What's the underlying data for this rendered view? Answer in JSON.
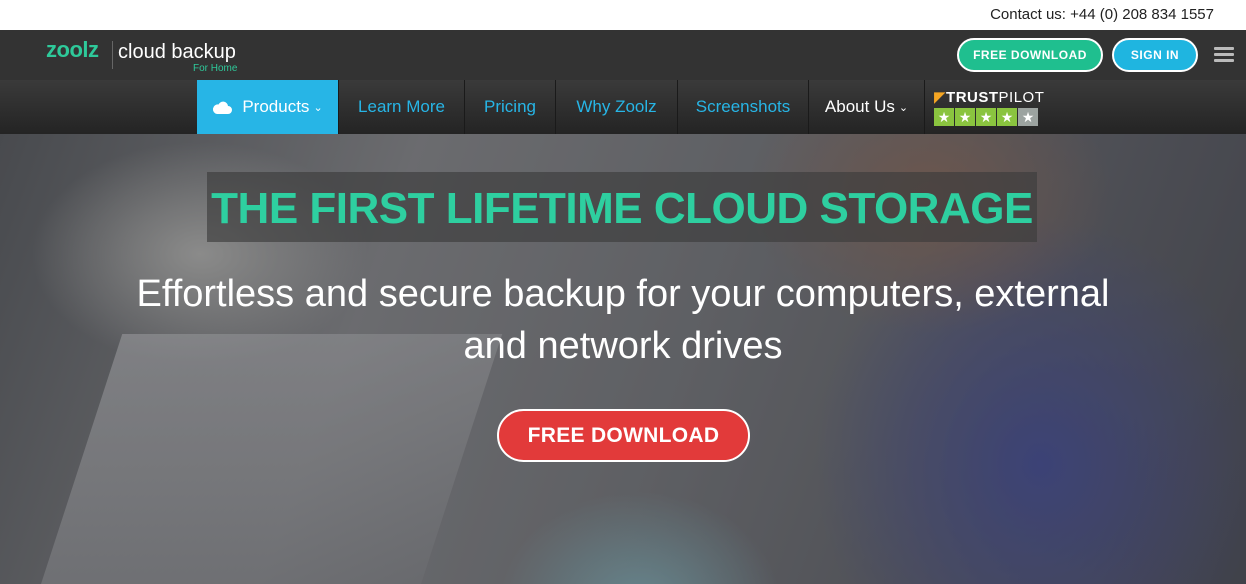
{
  "contact": {
    "text": "Contact us: +44 (0) 208 834 1557"
  },
  "header": {
    "logo_brand": "zoolz",
    "logo_product": "cloud backup",
    "logo_sub": "For Home",
    "free_download_label": "FREE DOWNLOAD",
    "sign_in_label": "SIGN IN",
    "menu_icon": "hamburger-menu-icon"
  },
  "nav": {
    "items": [
      {
        "label": "Products",
        "active": true,
        "icon": "cloud-icon",
        "has_dropdown": true
      },
      {
        "label": "Learn More"
      },
      {
        "label": "Pricing"
      },
      {
        "label": "Why Zoolz"
      },
      {
        "label": "Screenshots"
      },
      {
        "label": "About Us",
        "has_dropdown": true
      }
    ],
    "chevron": "⌄",
    "trustpilot": {
      "label_bold": "TRUST",
      "label_rest": "PILOT",
      "stars": 4.5
    }
  },
  "hero": {
    "headline": "THE FIRST LIFETIME CLOUD STORAGE",
    "subhead_line1": "Effortless and secure backup for your computers, external",
    "subhead_line2": "and network drives",
    "cta_label": "FREE DOWNLOAD"
  },
  "colors": {
    "brand_green": "#2ec99a",
    "accent_blue": "#27b5e6",
    "cta_red": "#e23a3a",
    "header_bg": "#333333"
  }
}
